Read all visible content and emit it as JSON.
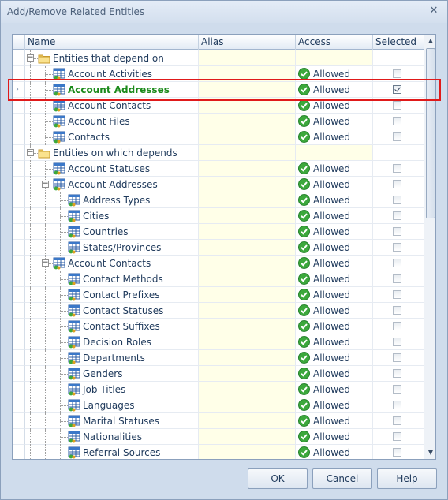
{
  "window": {
    "title": "Add/Remove Related Entities",
    "close_glyph": "✕"
  },
  "columns": {
    "name": "Name",
    "alias": "Alias",
    "access": "Access",
    "selected": "Selected"
  },
  "rows": [
    {
      "type": "group",
      "label": "Entities that depend on",
      "expander": "−",
      "level": 0
    },
    {
      "type": "entity",
      "label": "Account Activities",
      "level": 1,
      "access": "Allowed",
      "selected": false
    },
    {
      "type": "entity",
      "label": "Account Addresses",
      "level": 1,
      "access": "Allowed",
      "selected": true,
      "current": true
    },
    {
      "type": "entity",
      "label": "Account Contacts",
      "level": 1,
      "access": "Allowed",
      "selected": false
    },
    {
      "type": "entity",
      "label": "Account Files",
      "level": 1,
      "access": "Allowed",
      "selected": false
    },
    {
      "type": "entity",
      "label": "Contacts",
      "level": 1,
      "access": "Allowed",
      "selected": false
    },
    {
      "type": "group",
      "label": "Entities on which depends",
      "expander": "−",
      "level": 0
    },
    {
      "type": "entity",
      "label": "Account Statuses",
      "level": 1,
      "access": "Allowed",
      "selected": false
    },
    {
      "type": "entity",
      "label": "Account Addresses",
      "level": 1,
      "access": "Allowed",
      "selected": false,
      "expander": "−"
    },
    {
      "type": "entity",
      "label": "Address Types",
      "level": 2,
      "access": "Allowed",
      "selected": false
    },
    {
      "type": "entity",
      "label": "Cities",
      "level": 2,
      "access": "Allowed",
      "selected": false
    },
    {
      "type": "entity",
      "label": "Countries",
      "level": 2,
      "access": "Allowed",
      "selected": false
    },
    {
      "type": "entity",
      "label": "States/Provinces",
      "level": 2,
      "access": "Allowed",
      "selected": false
    },
    {
      "type": "entity",
      "label": "Account Contacts",
      "level": 1,
      "access": "Allowed",
      "selected": false,
      "expander": "−"
    },
    {
      "type": "entity",
      "label": "Contact Methods",
      "level": 2,
      "access": "Allowed",
      "selected": false
    },
    {
      "type": "entity",
      "label": "Contact Prefixes",
      "level": 2,
      "access": "Allowed",
      "selected": false
    },
    {
      "type": "entity",
      "label": "Contact Statuses",
      "level": 2,
      "access": "Allowed",
      "selected": false
    },
    {
      "type": "entity",
      "label": "Contact Suffixes",
      "level": 2,
      "access": "Allowed",
      "selected": false
    },
    {
      "type": "entity",
      "label": "Decision Roles",
      "level": 2,
      "access": "Allowed",
      "selected": false
    },
    {
      "type": "entity",
      "label": "Departments",
      "level": 2,
      "access": "Allowed",
      "selected": false
    },
    {
      "type": "entity",
      "label": "Genders",
      "level": 2,
      "access": "Allowed",
      "selected": false
    },
    {
      "type": "entity",
      "label": "Job Titles",
      "level": 2,
      "access": "Allowed",
      "selected": false
    },
    {
      "type": "entity",
      "label": "Languages",
      "level": 2,
      "access": "Allowed",
      "selected": false
    },
    {
      "type": "entity",
      "label": "Marital Statuses",
      "level": 2,
      "access": "Allowed",
      "selected": false
    },
    {
      "type": "entity",
      "label": "Nationalities",
      "level": 2,
      "access": "Allowed",
      "selected": false
    },
    {
      "type": "entity",
      "label": "Referral Sources",
      "level": 2,
      "access": "Allowed",
      "selected": false
    }
  ],
  "buttons": {
    "ok": "OK",
    "cancel": "Cancel",
    "help": "Help"
  },
  "colors": {
    "highlight_border": "#e01a1a",
    "highlight_text": "#1b8a1b",
    "allowed_icon": "#3ca83c"
  },
  "icons": {
    "group": "folder-icon",
    "entity": "table-entity-icon",
    "access": "allowed-check-icon",
    "row_pointer": "row-pointer-icon"
  }
}
